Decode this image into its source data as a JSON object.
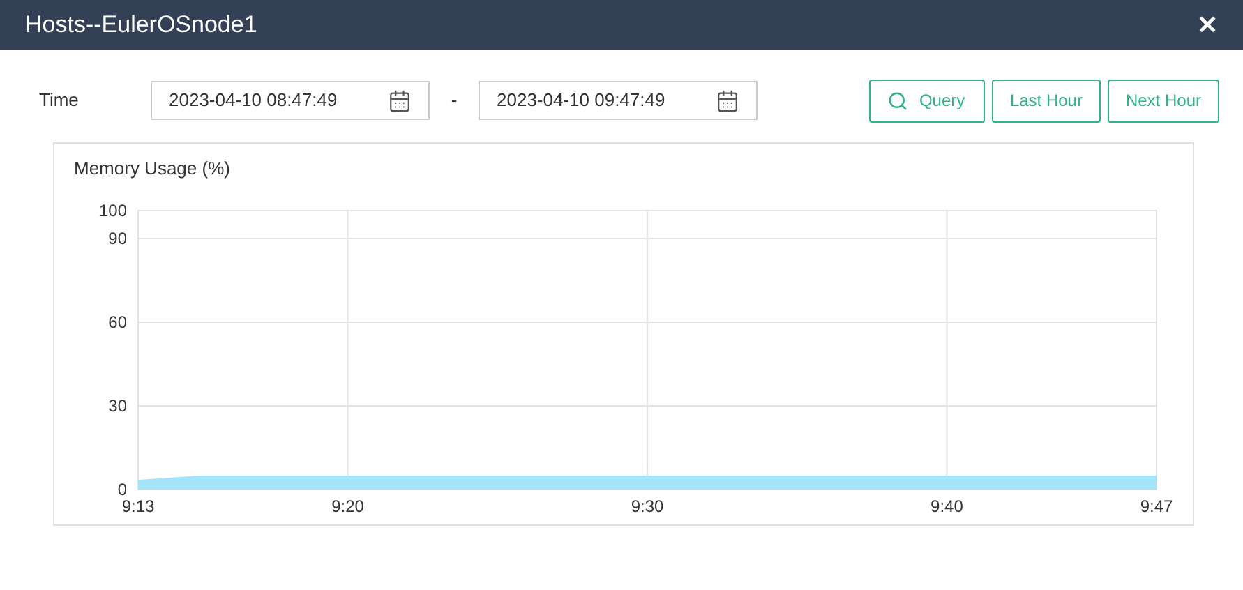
{
  "window": {
    "title": "Hosts--EulerOSnode1",
    "close": "✕"
  },
  "time_filter": {
    "label": "Time",
    "start": "2023-04-10 08:47:49",
    "separator": "-",
    "end": "2023-04-10 09:47:49"
  },
  "buttons": [
    {
      "label": "Query",
      "kind": "search"
    },
    {
      "label": "Last Hour",
      "kind": "plain"
    },
    {
      "label": "Next Hour",
      "kind": "plain"
    }
  ],
  "chart": {
    "title": "Memory Usage (%)",
    "chart_data": {
      "type": "area",
      "categories": [
        "9:13",
        null,
        null,
        null,
        null,
        null,
        null,
        "9:20",
        null,
        null,
        null,
        null,
        null,
        null,
        null,
        null,
        null,
        "9:30",
        null,
        null,
        null,
        null,
        null,
        null,
        null,
        null,
        null,
        "9:40",
        null,
        null,
        null,
        null,
        null,
        null,
        "9:47"
      ],
      "series": [
        {
          "color": "#a3e4fb",
          "values": [
            3.5,
            4.2,
            5,
            5,
            5,
            5,
            5,
            5,
            5,
            5,
            5,
            5,
            5,
            5,
            5,
            5,
            5,
            5,
            5,
            5,
            5,
            5,
            5,
            5,
            5,
            5,
            5,
            5,
            5,
            5,
            5,
            5,
            5,
            5,
            5
          ]
        }
      ],
      "ylim": [
        0,
        100
      ],
      "grid": true,
      "yticks": [
        0,
        30,
        60,
        90,
        100
      ]
    }
  }
}
